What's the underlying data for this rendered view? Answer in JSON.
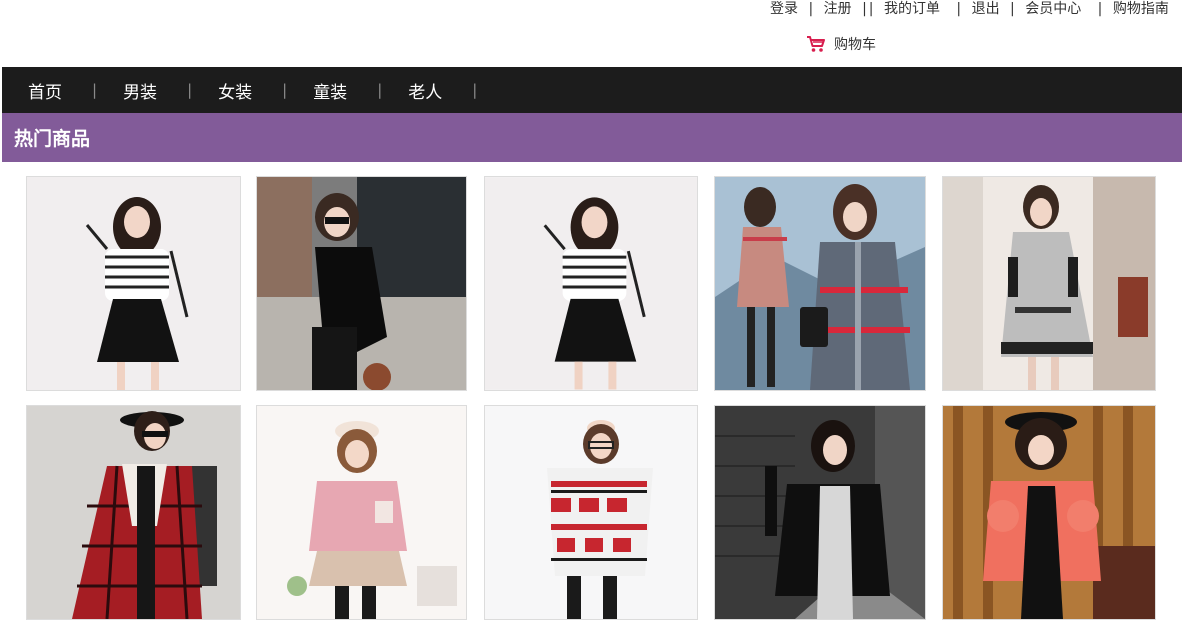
{
  "top_links": {
    "login": "登录",
    "register": "注册",
    "my_orders": "我的订单",
    "logout": "退出",
    "member_center": "会员中心",
    "shopping_guide": "购物指南",
    "separator": "|"
  },
  "cart": {
    "label": "购物车",
    "icon": "shopping-cart-icon",
    "icon_color": "#d81e4e"
  },
  "nav": {
    "items": [
      {
        "label": "首页"
      },
      {
        "label": "男装"
      },
      {
        "label": "女装"
      },
      {
        "label": "童装"
      },
      {
        "label": "老人"
      }
    ],
    "separator": "|",
    "background": "#1c1c1c"
  },
  "section": {
    "title": "热门商品",
    "background": "#825b99"
  },
  "products": [
    {
      "name": "striped-sweater-black-skirt"
    },
    {
      "name": "black-cold-shoulder-top"
    },
    {
      "name": "striped-sweater-black-skirt-2"
    },
    {
      "name": "plaid-coat-snow"
    },
    {
      "name": "grey-belted-coat"
    },
    {
      "name": "red-plaid-coat"
    },
    {
      "name": "pink-knit-sweater"
    },
    {
      "name": "reindeer-pattern-sweater"
    },
    {
      "name": "black-leather-jacket"
    },
    {
      "name": "coral-fur-jacket"
    }
  ]
}
